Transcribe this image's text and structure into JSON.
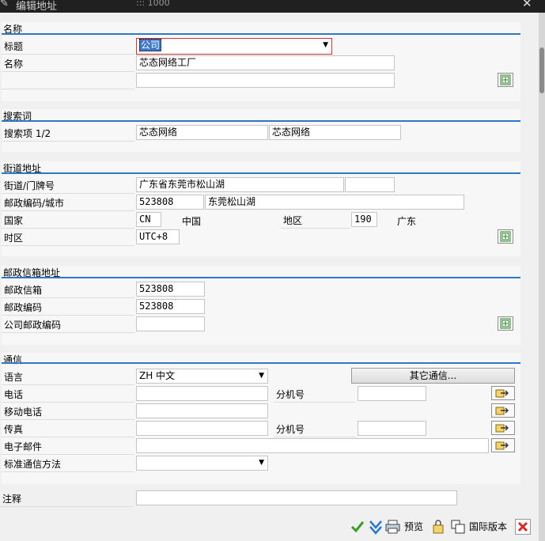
{
  "window": {
    "title": "编辑地址",
    "number": "::: 1000",
    "close_glyph": "✕"
  },
  "name_section": {
    "header": "名称",
    "title_label": "标题",
    "title_value": "公司",
    "name_label": "名称",
    "name_value": "芯态网络工厂",
    "name2_value": ""
  },
  "search_section": {
    "header": "搜索词",
    "label": "搜索项 1/2",
    "term1": "芯态网络",
    "term2": "芯态网络"
  },
  "street_section": {
    "header": "街道地址",
    "street_label": "街道/门牌号",
    "street_value": "广东省东莞市松山湖",
    "house_value": "",
    "postal_city_label": "邮政编码/城市",
    "postal_value": "523808",
    "city_value": "东莞松山湖",
    "country_label": "国家",
    "country_code": "CN",
    "country_name": "中国",
    "region_label": "地区",
    "region_code": "190",
    "region_name": "广东",
    "timezone_label": "时区",
    "timezone_value": "UTC+8"
  },
  "pobox_section": {
    "header": "邮政信箱地址",
    "pobox_label": "邮政信箱",
    "pobox_value": "523808",
    "postal_label": "邮政编码",
    "postal_value": "523808",
    "company_postal_label": "公司邮政编码",
    "company_postal_value": ""
  },
  "comm_section": {
    "header": "通信",
    "language_label": "语言",
    "language_value": "ZH 中文",
    "other_comm_button": "其它通信...",
    "phone_label": "电话",
    "phone_value": "",
    "ext_label": "分机号",
    "phone_ext_value": "",
    "mobile_label": "移动电话",
    "mobile_value": "",
    "fax_label": "传真",
    "fax_value": "",
    "fax_ext_label": "分机号",
    "fax_ext_value": "",
    "email_label": "电子邮件",
    "email_value": "",
    "std_comm_label": "标准通信方法",
    "std_comm_value": ""
  },
  "remarks": {
    "label": "注释",
    "value": ""
  },
  "toolbar": {
    "preview_label": "预览",
    "intl_label": "国际版本"
  },
  "colors": {
    "accent": "#2b78c6",
    "titlebar": "#202020",
    "confirm": "#3a9d23",
    "cancel": "#d42a2a"
  },
  "icons": [
    "expand-icon",
    "arrow-right-icon",
    "checkmark-icon",
    "continue-icon",
    "print-preview-icon",
    "check-icon",
    "international-version-icon",
    "cancel-icon"
  ]
}
